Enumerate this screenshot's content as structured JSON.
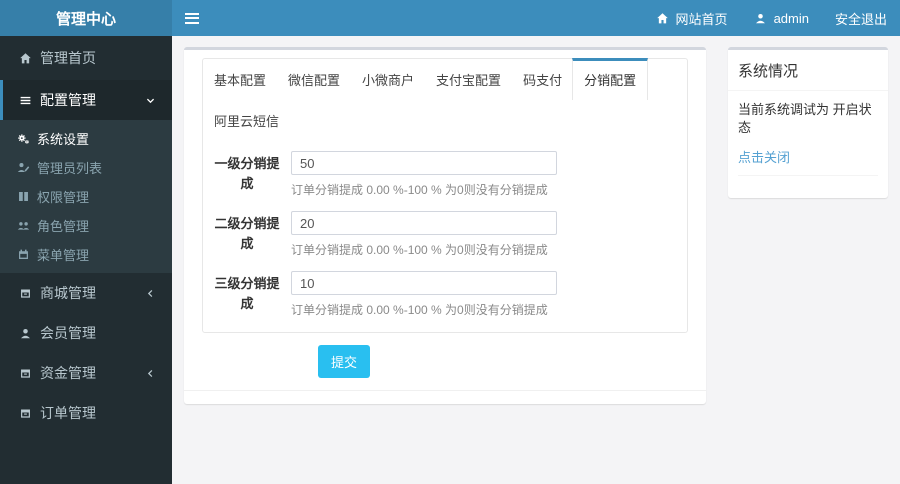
{
  "header": {
    "brand": "管理中心",
    "nav": {
      "site_home": "网站首页",
      "username": "admin",
      "logout": "安全退出"
    }
  },
  "sidebar": {
    "items": [
      {
        "label": "管理首页",
        "icon": "home-icon"
      },
      {
        "label": "配置管理",
        "icon": "bars-icon",
        "expanded": true,
        "children": [
          {
            "label": "系统设置",
            "icon": "gears-icon",
            "active": true
          },
          {
            "label": "管理员列表",
            "icon": "user-edit-icon"
          },
          {
            "label": "权限管理",
            "icon": "columns-icon"
          },
          {
            "label": "角色管理",
            "icon": "users-icon"
          },
          {
            "label": "菜单管理",
            "icon": "calendar-icon"
          }
        ]
      },
      {
        "label": "商城管理",
        "icon": "archive-icon",
        "collapsed": true
      },
      {
        "label": "会员管理",
        "icon": "user-icon"
      },
      {
        "label": "资金管理",
        "icon": "archive-icon",
        "collapsed": true
      },
      {
        "label": "订单管理",
        "icon": "archive-icon"
      }
    ]
  },
  "main": {
    "tabs_row1": [
      "基本配置",
      "微信配置",
      "小微商户",
      "支付宝配置",
      "码支付",
      "分销配置"
    ],
    "tabs_row2": [
      "阿里云短信"
    ],
    "active_tab": "分销配置",
    "form": {
      "rows": [
        {
          "label": "一级分销提成",
          "value": "50",
          "help": "订单分销提成 0.00 %-100 % 为0则没有分销提成"
        },
        {
          "label": "二级分销提成",
          "value": "20",
          "help": "订单分销提成 0.00 %-100 % 为0则没有分销提成"
        },
        {
          "label": "三级分销提成",
          "value": "10",
          "help": "订单分销提成 0.00 %-100 % 为0则没有分销提成"
        }
      ],
      "submit_label": "提交"
    }
  },
  "aside": {
    "title": "系统情况",
    "status_text": "当前系统调试为 开启状态",
    "link_label": "点击关闭"
  },
  "colors": {
    "navbar": "#3c8dbc",
    "brand_bg": "#367fa9",
    "sidebar_bg": "#222d32",
    "submenu_bg": "#2c3b41",
    "content_bg": "#f4f4f6",
    "card_top_border": "#d2d6de",
    "active_tab_border": "#3c8dbc",
    "submit_button": "#29bff0",
    "link": "#55a1d2"
  }
}
